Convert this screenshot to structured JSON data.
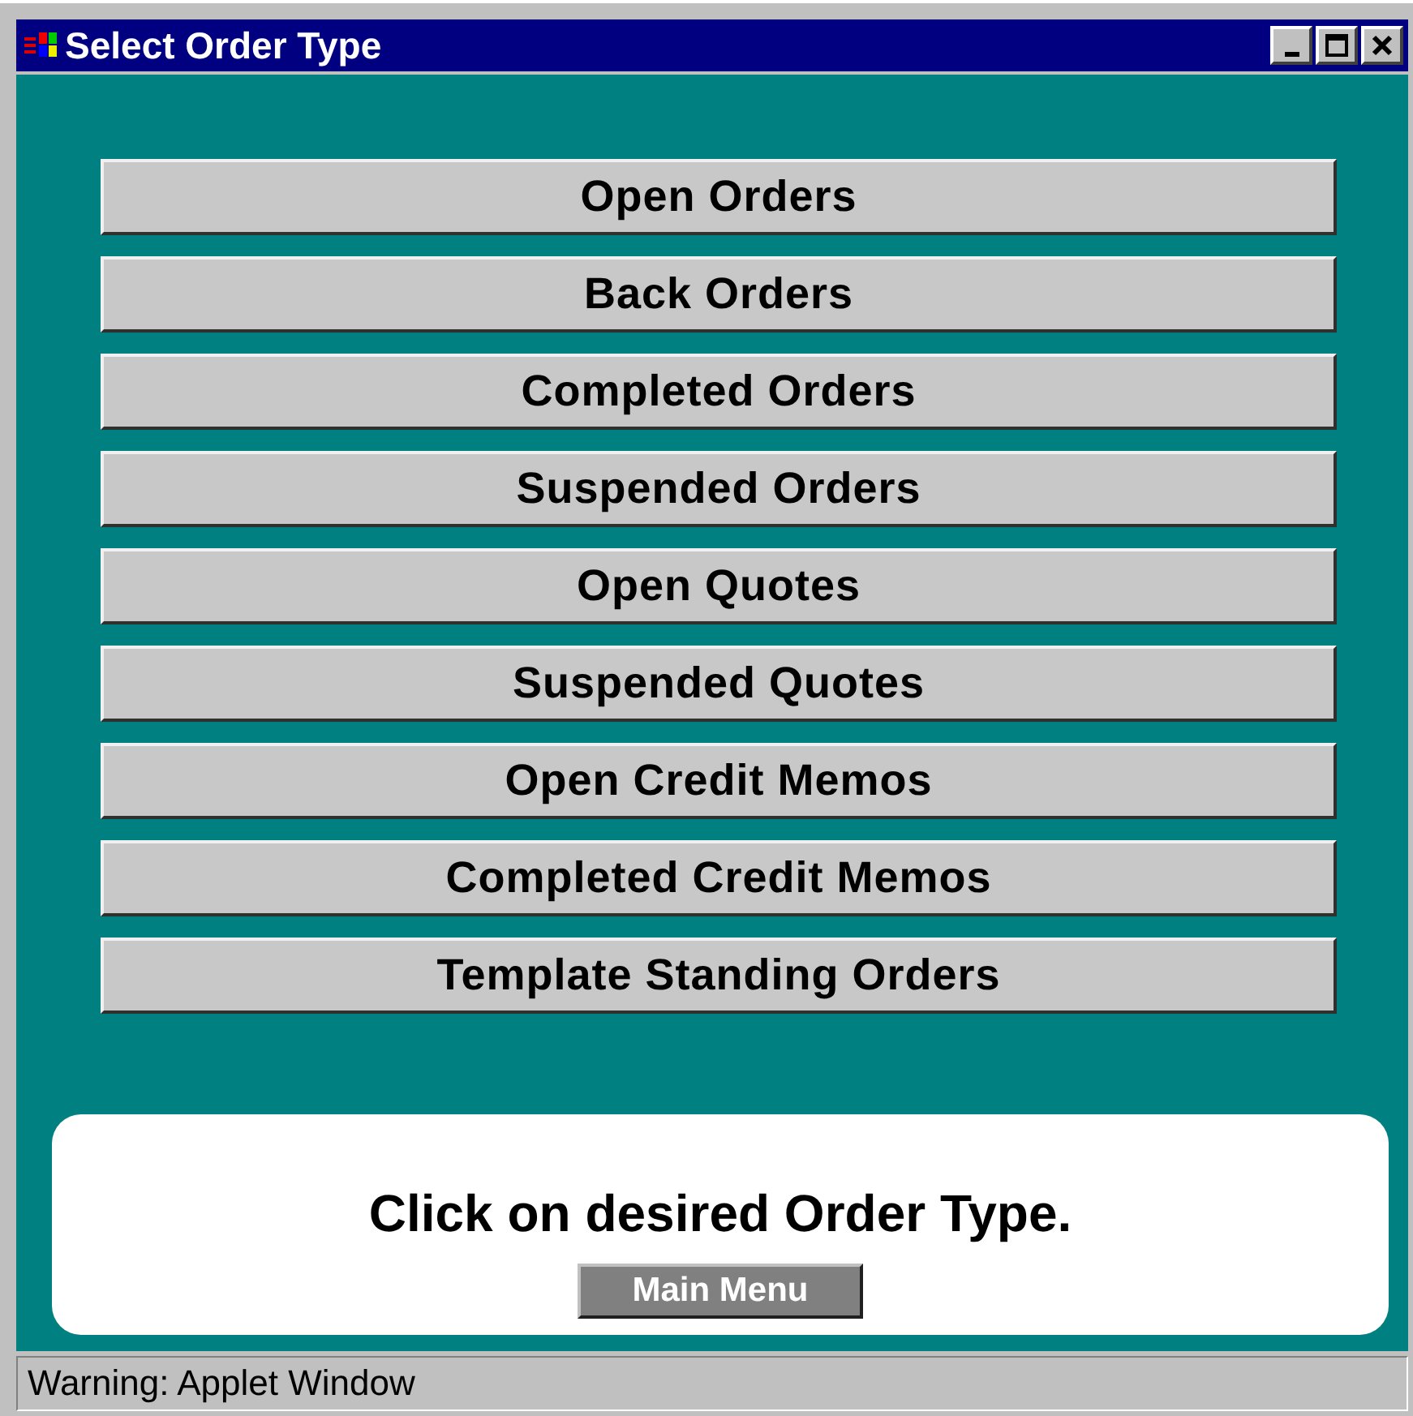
{
  "window": {
    "title": "Select Order Type"
  },
  "order_types": [
    {
      "label": "Open Orders"
    },
    {
      "label": "Back Orders"
    },
    {
      "label": "Completed Orders"
    },
    {
      "label": "Suspended Orders"
    },
    {
      "label": "Open Quotes"
    },
    {
      "label": "Suspended Quotes"
    },
    {
      "label": "Open Credit Memos"
    },
    {
      "label": "Completed Credit Memos"
    },
    {
      "label": "Template Standing Orders"
    }
  ],
  "instruction": "Click on desired Order Type.",
  "main_menu_button": "Main Menu",
  "status_bar": "Warning: Applet Window"
}
